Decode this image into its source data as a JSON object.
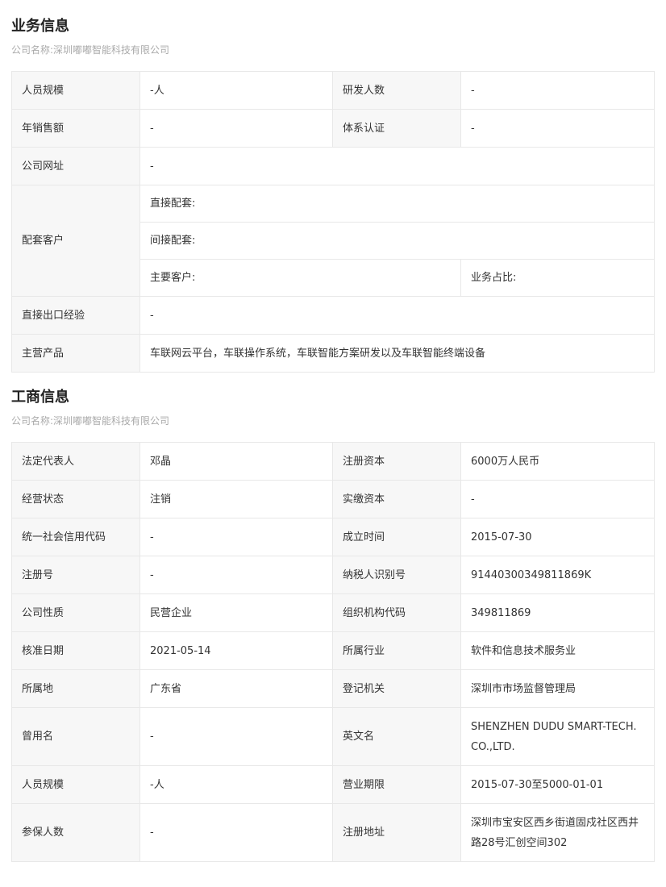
{
  "business": {
    "title": "业务信息",
    "company_line": "公司名称:深圳嘟嘟智能科技有限公司",
    "staff_size_label": "人员规模",
    "staff_size_value": "-人",
    "rd_count_label": "研发人数",
    "rd_count_value": "-",
    "annual_sales_label": "年销售额",
    "annual_sales_value": "-",
    "certification_label": "体系认证",
    "certification_value": "-",
    "website_label": "公司网址",
    "website_value": "-",
    "customers_label": "配套客户",
    "direct_label": "直接配套:",
    "indirect_label": "间接配套:",
    "main_customers_label": "主要客户:",
    "business_share_label": "业务占比:",
    "export_label": "直接出口经验",
    "export_value": "-",
    "products_label": "主营产品",
    "products_value": "车联网云平台，车联操作系统，车联智能方案研发以及车联智能终端设备"
  },
  "commerce": {
    "title": "工商信息",
    "company_line": "公司名称:深圳嘟嘟智能科技有限公司",
    "rows": [
      {
        "l1": "法定代表人",
        "v1": "邓晶",
        "l2": "注册资本",
        "v2": "6000万人民币"
      },
      {
        "l1": "经营状态",
        "v1": "注销",
        "l2": "实缴资本",
        "v2": "-"
      },
      {
        "l1": "统一社会信用代码",
        "v1": "-",
        "l2": "成立时间",
        "v2": "2015-07-30"
      },
      {
        "l1": "注册号",
        "v1": "-",
        "l2": "纳税人识别号",
        "v2": "91440300349811869K"
      },
      {
        "l1": "公司性质",
        "v1": "民营企业",
        "l2": "组织机构代码",
        "v2": "349811869"
      },
      {
        "l1": "核准日期",
        "v1": "2021-05-14",
        "l2": "所属行业",
        "v2": "软件和信息技术服务业"
      },
      {
        "l1": "所属地",
        "v1": "广东省",
        "l2": "登记机关",
        "v2": "深圳市市场监督管理局"
      },
      {
        "l1": "曾用名",
        "v1": "-",
        "l2": "英文名",
        "v2": "SHENZHEN DUDU SMART-TECH. CO.,LTD."
      },
      {
        "l1": "人员规模",
        "v1": "-人",
        "l2": "营业期限",
        "v2": "2015-07-30至5000-01-01"
      },
      {
        "l1": "参保人数",
        "v1": "-",
        "l2": "注册地址",
        "v2": "深圳市宝安区西乡街道固戍社区西井路28号汇创空间302"
      }
    ]
  }
}
